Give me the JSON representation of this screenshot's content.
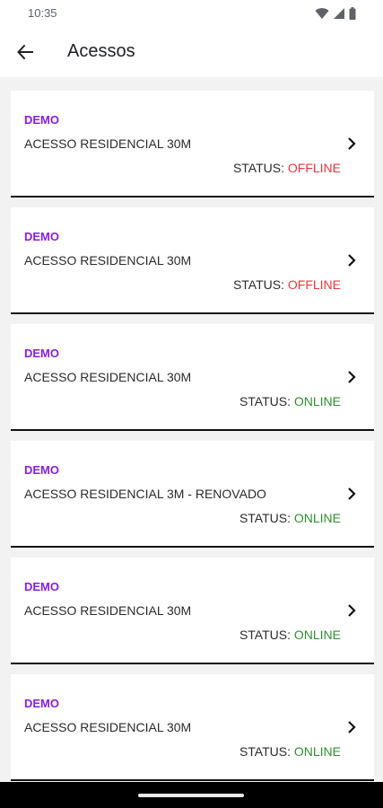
{
  "status_bar": {
    "time": "10:35",
    "icons": [
      "wifi-icon",
      "signal-icon",
      "battery-icon"
    ]
  },
  "app_bar": {
    "title": "Acessos",
    "back_icon": "arrow-left-icon"
  },
  "colors": {
    "accent": "#8a1ce6",
    "offline": "#f0343c",
    "online": "#2f8f2f",
    "text": "#2b2b2b",
    "background": "#f2f2f2"
  },
  "accesses": [
    {
      "name": "DEMO",
      "plan": "ACESSO RESIDENCIAL 30M",
      "status_label": "STATUS: ",
      "status": "OFFLINE"
    },
    {
      "name": "DEMO",
      "plan": "ACESSO RESIDENCIAL 30M",
      "status_label": "STATUS: ",
      "status": "OFFLINE"
    },
    {
      "name": "DEMO",
      "plan": "ACESSO RESIDENCIAL 30M",
      "status_label": "STATUS: ",
      "status": "ONLINE"
    },
    {
      "name": "DEMO",
      "plan": "ACESSO RESIDENCIAL 3M - RENOVADO",
      "status_label": "STATUS: ",
      "status": "ONLINE"
    },
    {
      "name": "DEMO",
      "plan": "ACESSO RESIDENCIAL 30M",
      "status_label": "STATUS: ",
      "status": "ONLINE"
    },
    {
      "name": "DEMO",
      "plan": "ACESSO RESIDENCIAL 30M",
      "status_label": "STATUS: ",
      "status": "ONLINE"
    }
  ]
}
